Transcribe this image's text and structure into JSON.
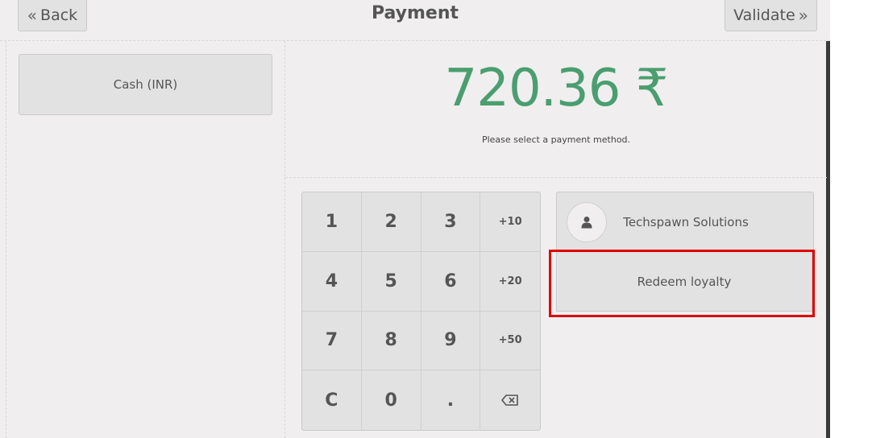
{
  "header": {
    "title": "Payment",
    "back_label": "Back",
    "validate_label": "Validate"
  },
  "payment_methods": [
    {
      "label": "Cash (INR)"
    }
  ],
  "summary": {
    "total": "720.36 ₹",
    "hint": "Please select a payment method."
  },
  "numpad": {
    "keys": [
      "1",
      "2",
      "3",
      "+10",
      "4",
      "5",
      "6",
      "+20",
      "7",
      "8",
      "9",
      "+50",
      "C",
      "0",
      ".",
      "⌫"
    ]
  },
  "customer": {
    "name": "Techspawn Solutions",
    "icon": "user-icon"
  },
  "loyalty": {
    "label": "Redeem loyalty"
  },
  "colors": {
    "total_green": "#4a9e70",
    "highlight_red": "#e00000",
    "button_bg": "#e2e2e2",
    "page_bg": "#f0eeee"
  }
}
